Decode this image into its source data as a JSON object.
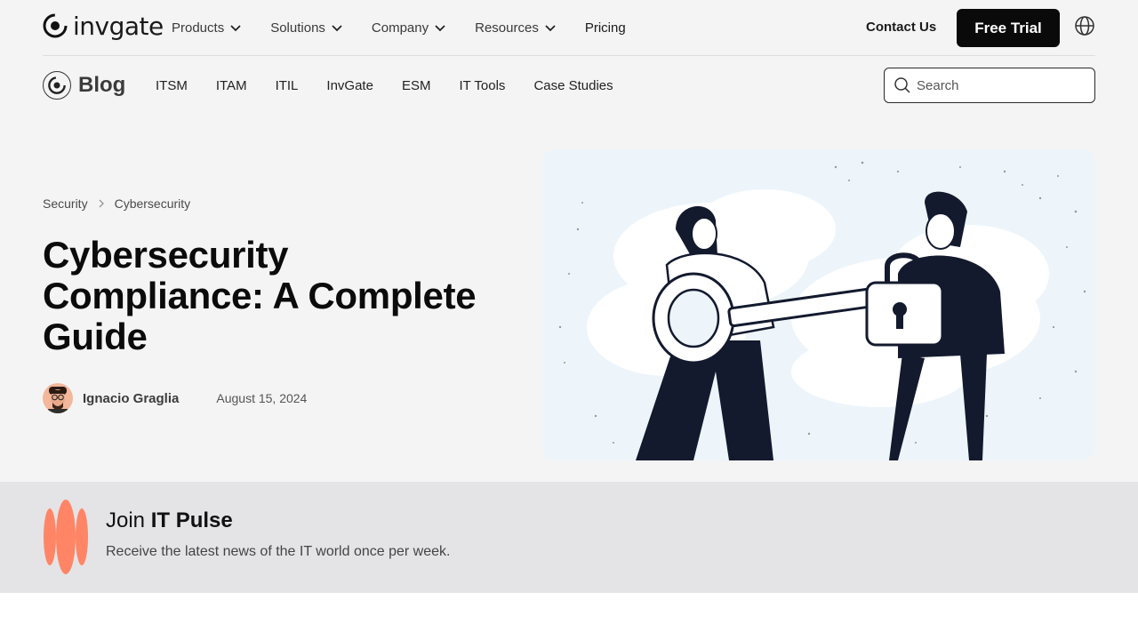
{
  "header": {
    "logo_text": "invgate",
    "menu": [
      {
        "label": "Products"
      },
      {
        "label": "Solutions"
      },
      {
        "label": "Company"
      },
      {
        "label": "Resources"
      },
      {
        "label": "Pricing"
      }
    ],
    "contact_label": "Contact Us",
    "free_trial_label": "Free Trial"
  },
  "subnav": {
    "blog_label": "Blog",
    "links": [
      "ITSM",
      "ITAM",
      "ITIL",
      "InvGate",
      "ESM",
      "IT Tools",
      "Case Studies"
    ],
    "search_placeholder": "Search"
  },
  "article": {
    "breadcrumb": [
      "Security",
      "Cybersecurity"
    ],
    "title": "Cybersecurity Compliance: A Complete Guide",
    "author": "Ignacio Graglia",
    "date": "August 15, 2024"
  },
  "newsletter": {
    "join_text": "Join ",
    "brand": "IT Pulse",
    "subtitle": "Receive the latest news of the IT world once per week."
  },
  "colors": {
    "page_bg": "#f4f4f4",
    "newsletter_bg": "#e4e4e6",
    "primary_button": "#0a0a0a",
    "pulse_accent": "#ff8566"
  }
}
